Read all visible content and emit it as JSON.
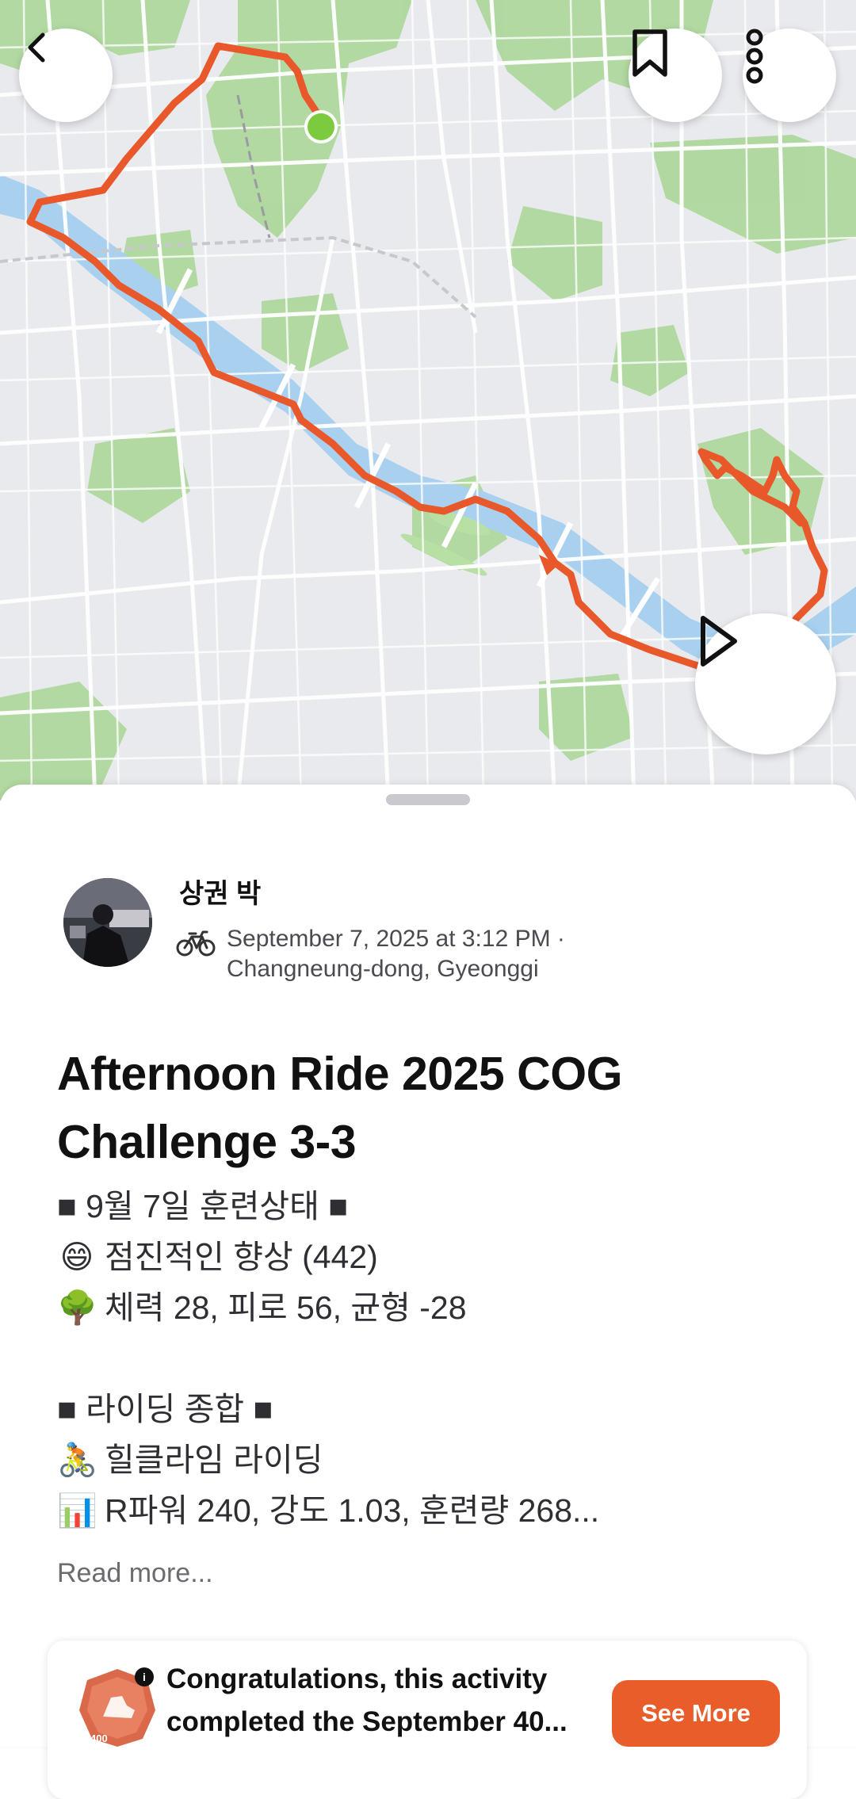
{
  "colors": {
    "route": "#e8582a",
    "river": "#a9d1ef",
    "park": "#9fd089",
    "accent": "#e85d2a",
    "start_marker": "#7ccb3f"
  },
  "map": {
    "icons": {
      "back": "chevron-left-icon",
      "bookmark": "bookmark-icon",
      "more": "more-vertical-icon",
      "play": "play-icon"
    }
  },
  "activity": {
    "athlete_name": "상권 박",
    "sport_icon": "bicycle-icon",
    "date_line": "September 7, 2025 at 3:12 PM ·",
    "location_line": "Changneung-dong, Gyeonggi",
    "title_line1": "Afternoon Ride 2025 COG",
    "title_line2": "Challenge 3-3",
    "description": [
      {
        "emoji": "",
        "text": "■ 9월 7일 훈련상태 ■"
      },
      {
        "emoji": "😄",
        "text": "점진적인 향상 (442)"
      },
      {
        "emoji": "🌳",
        "text": "체력 28, 피로 56, 균형 -28"
      },
      {
        "emoji": "",
        "text": ""
      },
      {
        "emoji": "",
        "text": "■ 라이딩 종합 ■"
      },
      {
        "emoji": "🚴",
        "text": "힐클라임 라이딩"
      },
      {
        "emoji": "📊",
        "text": "R파워 240, 강도 1.03, 훈련량 268..."
      }
    ],
    "read_more": "Read more..."
  },
  "promo": {
    "line1": "Congratulations, this activity",
    "line2": "completed the September 40...",
    "button": "See More",
    "badge_icon": "challenge-badge-icon",
    "badge_number": "400"
  }
}
